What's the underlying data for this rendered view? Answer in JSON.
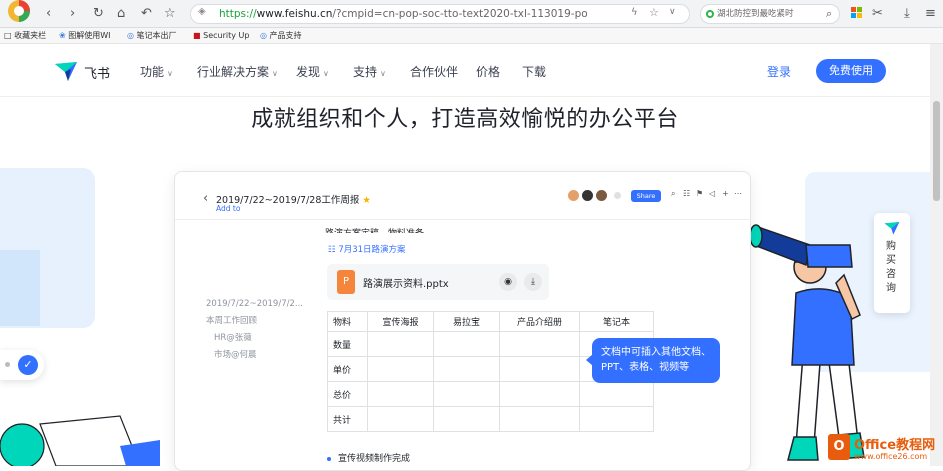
{
  "browser": {
    "url_scheme": "https://",
    "url_host": "www.feishu.cn",
    "url_path": "/?cmpid=cn-pop-soc-tto-text2020-txl-113019-po",
    "search_placeholder": "湖北防控到最吃紧时",
    "bookmarks": [
      "收藏夹栏",
      "图解使用WI",
      "笔记本出厂",
      "Security Up",
      "产品支持"
    ]
  },
  "nav": {
    "logo_text": "飞书",
    "items": [
      {
        "label": "功能",
        "has_dropdown": true
      },
      {
        "label": "行业解决方案",
        "has_dropdown": true
      },
      {
        "label": "发现",
        "has_dropdown": true
      },
      {
        "label": "支持",
        "has_dropdown": true
      },
      {
        "label": "合作伙伴",
        "has_dropdown": false
      },
      {
        "label": "价格",
        "has_dropdown": false
      },
      {
        "label": "下载",
        "has_dropdown": false
      }
    ],
    "login": "登录",
    "free_trial": "免费使用"
  },
  "hero": {
    "title": "成就组织和个人，打造高效愉悦的办公平台"
  },
  "doc": {
    "title": "2019/7/22~2019/7/28工作周报",
    "subtitle": "Add to",
    "share": "Share",
    "outline": [
      "2019/7/22~2019/7/2...",
      "本周工作回顾",
      "HR@张薇",
      "市场@何晨"
    ],
    "cut_line": "路演方案定稿、物料准备",
    "link_text": "7月31日路演方案",
    "file_icon_letter": "P",
    "file_name": "路演展示资料.pptx",
    "table": {
      "header": [
        "物料",
        "宣传海报",
        "易拉宝",
        "产品介绍册",
        "笔记本"
      ],
      "rows": [
        "数量",
        "单价",
        "总价",
        "共计"
      ]
    },
    "bullet": "宣传视频制作完成"
  },
  "tooltip": {
    "line1": "文档中可插入其他文档、",
    "line2": "PPT、表格、视频等"
  },
  "side_panel": {
    "text": "购买咨询"
  },
  "watermark": {
    "icon": "O",
    "title": "Office教程网",
    "url": "www.office26.com"
  },
  "colors": {
    "brand_blue": "#3370ff",
    "star": "#f5b400",
    "ppt_orange": "#f5853b"
  }
}
